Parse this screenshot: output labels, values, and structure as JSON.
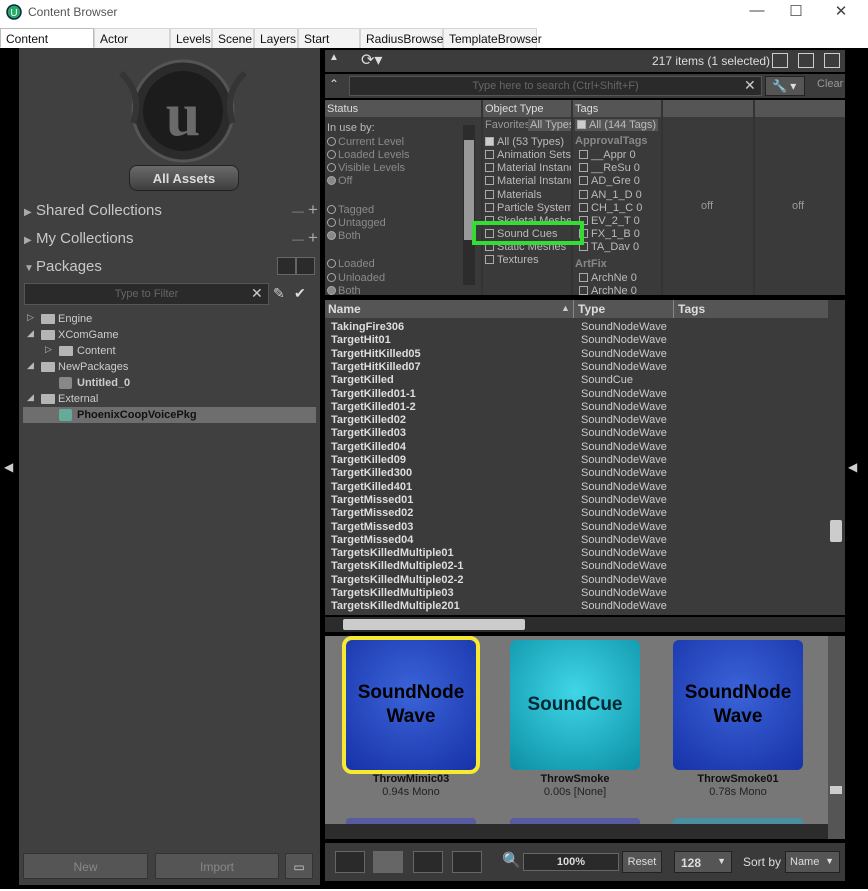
{
  "window": {
    "title": "Content Browser",
    "minimize": "—",
    "maximize": "☐",
    "close": "✕"
  },
  "tabs": [
    "Content Browser",
    "Actor Classes",
    "Levels",
    "Scene",
    "Layers",
    "Start Page",
    "RadiusBrowser",
    "TemplateBrowser"
  ],
  "left": {
    "all_assets": "All Assets",
    "shared_collections": "Shared Collections",
    "my_collections": "My Collections",
    "packages": "Packages",
    "filter_placeholder": "Type to Filter",
    "tree": [
      {
        "label": "Engine",
        "indent": 0,
        "arrow": "▷",
        "icon": "folder"
      },
      {
        "label": "XComGame",
        "indent": 0,
        "arrow": "◢",
        "icon": "folder"
      },
      {
        "label": "Content",
        "indent": 1,
        "arrow": "▷",
        "icon": "folder"
      },
      {
        "label": "NewPackages",
        "indent": 0,
        "arrow": "◢",
        "icon": "folder"
      },
      {
        "label": "Untitled_0",
        "indent": 1,
        "arrow": "",
        "icon": "package"
      },
      {
        "label": "External",
        "indent": 0,
        "arrow": "◢",
        "icon": "folder"
      },
      {
        "label": "PhoenixCoopVoicePkg",
        "indent": 1,
        "arrow": "",
        "icon": "package",
        "selected": true
      }
    ],
    "new_button": "New",
    "import_button": "Import"
  },
  "toolbar": {
    "count": "217 items (1 selected)"
  },
  "search": {
    "placeholder": "Type here to search  (Ctrl+Shift+F)",
    "clear": "Clear"
  },
  "filters": {
    "status_header": "Status",
    "object_type_header": "Object Type",
    "tags_header": "Tags",
    "in_use_by": "In use by:",
    "status_radios": [
      "Current Level",
      "Loaded Levels",
      "Visible Levels",
      "Off"
    ],
    "tag_radios": [
      "Tagged",
      "Untagged",
      "Both"
    ],
    "load_radios": [
      "Loaded",
      "Unloaded",
      "Both"
    ],
    "favorites_tab": "Favorites",
    "all_types_tab": "All Types",
    "types": [
      "All (53 Types)",
      "Animation Sets",
      "Material Instances",
      "Material Instances",
      "Materials",
      "Particle Systems",
      "Skeletal Meshes",
      "Sound Cues",
      "Static Meshes",
      "Textures"
    ],
    "tags_all": "All (144 Tags)",
    "tag_group1": "ApprovalTags",
    "tags": [
      "__Appr 0",
      "__ReSu 0",
      "AD_Gre 0",
      "AN_1_D 0",
      "CH_1_C 0",
      "EV_2_T 0",
      "FX_1_B 0",
      "TA_Dav 0"
    ],
    "tag_group2": "ArtFix",
    "tags2": [
      "ArchNe 0",
      "ArchNe 0"
    ],
    "off1": "off",
    "off2": "off"
  },
  "list": {
    "name_header": "Name",
    "type_header": "Type",
    "tags_header": "Tags",
    "rows": [
      [
        "TakingFire306",
        "SoundNodeWave"
      ],
      [
        "TargetHit01",
        "SoundNodeWave"
      ],
      [
        "TargetHitKilled05",
        "SoundNodeWave"
      ],
      [
        "TargetHitKilled07",
        "SoundNodeWave"
      ],
      [
        "TargetKilled",
        "SoundCue"
      ],
      [
        "TargetKilled01-1",
        "SoundNodeWave"
      ],
      [
        "TargetKilled01-2",
        "SoundNodeWave"
      ],
      [
        "TargetKilled02",
        "SoundNodeWave"
      ],
      [
        "TargetKilled03",
        "SoundNodeWave"
      ],
      [
        "TargetKilled04",
        "SoundNodeWave"
      ],
      [
        "TargetKilled09",
        "SoundNodeWave"
      ],
      [
        "TargetKilled300",
        "SoundNodeWave"
      ],
      [
        "TargetKilled401",
        "SoundNodeWave"
      ],
      [
        "TargetMissed01",
        "SoundNodeWave"
      ],
      [
        "TargetMissed02",
        "SoundNodeWave"
      ],
      [
        "TargetMissed03",
        "SoundNodeWave"
      ],
      [
        "TargetMissed04",
        "SoundNodeWave"
      ],
      [
        "TargetsKilledMultiple01",
        "SoundNodeWave"
      ],
      [
        "TargetsKilledMultiple02-1",
        "SoundNodeWave"
      ],
      [
        "TargetsKilledMultiple02-2",
        "SoundNodeWave"
      ],
      [
        "TargetsKilledMultiple03",
        "SoundNodeWave"
      ],
      [
        "TargetsKilledMultiple201",
        "SoundNodeWave"
      ]
    ]
  },
  "thumbs": [
    {
      "label1": "SoundNode",
      "label2": "Wave",
      "kind": "wave",
      "name": "ThrowMimic03",
      "sub": "0.94s Mono",
      "selected": true
    },
    {
      "label1": "SoundCue",
      "label2": "",
      "kind": "cue",
      "name": "ThrowSmoke",
      "sub": "0.00s [None]",
      "selected": false
    },
    {
      "label1": "SoundNode",
      "label2": "Wave",
      "kind": "wave",
      "name": "ThrowSmoke01",
      "sub": "0.78s Mono",
      "selected": false
    }
  ],
  "bottom": {
    "zoom": "100%",
    "reset": "Reset",
    "size": "128",
    "sort_label": "Sort by",
    "sort_value": "Name"
  }
}
